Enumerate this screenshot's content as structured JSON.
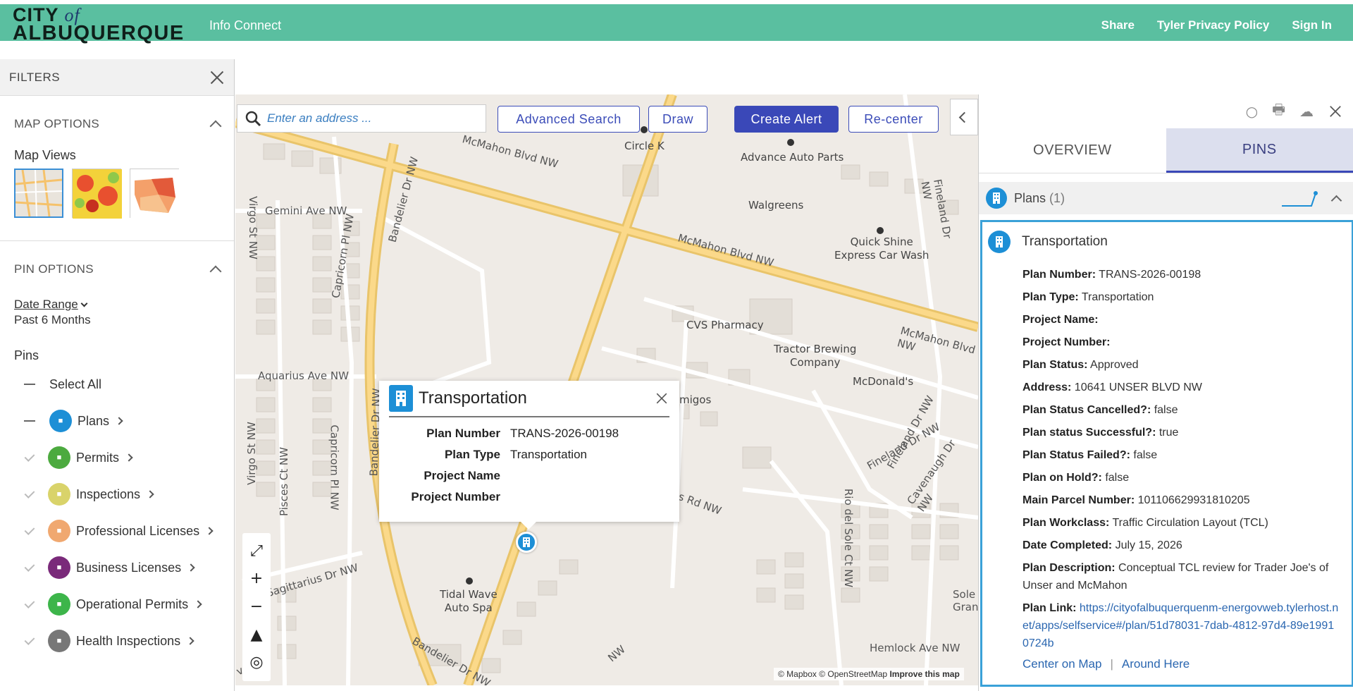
{
  "header": {
    "logo_line1_city": "CITY",
    "logo_line1_of": "of",
    "logo_line2": "ALBUQUERQUE",
    "app_title": "Info Connect",
    "nav": [
      "Share",
      "Tyler Privacy Policy",
      "Sign In"
    ],
    "bg_color": "#5abfa0"
  },
  "filters": {
    "title": "FILTERS",
    "map_options_title": "MAP OPTIONS",
    "map_views_label": "Map Views",
    "pin_options_title": "PIN OPTIONS",
    "date_range_label": "Date Range",
    "date_range_value": "Past 6 Months",
    "pins_title": "Pins",
    "select_all": "Select All",
    "pins": [
      {
        "label": "Plans",
        "color": "#1d8fd6",
        "state": "selected"
      },
      {
        "label": "Permits",
        "color": "#4caa3f",
        "state": "unselected"
      },
      {
        "label": "Inspections",
        "color": "#d9d36a",
        "state": "unselected"
      },
      {
        "label": "Professional Licenses",
        "color": "#f0a870",
        "state": "unselected"
      },
      {
        "label": "Business Licenses",
        "color": "#7a2a7a",
        "state": "unselected"
      },
      {
        "label": "Operational Permits",
        "color": "#3db54a",
        "state": "unselected"
      },
      {
        "label": "Health Inspections",
        "color": "#777777",
        "state": "unselected"
      }
    ]
  },
  "map": {
    "search_placeholder": "Enter an address ...",
    "buttons": {
      "advanced_search": "Advanced Search",
      "draw": "Draw",
      "create_alert": "Create Alert",
      "recenter": "Re-center"
    },
    "attribution": "© Mapbox © OpenStreetMap",
    "attribution_link": "Improve this map",
    "labels": {
      "circle_k": "Circle K",
      "advance_auto": "Advance Auto Parts",
      "walgreens": "Walgreens",
      "quick_shine_1": "Quick Shine",
      "quick_shine_2": "Express Car Wash",
      "cvs": "CVS Pharmacy",
      "tractor_1": "Tractor Brewing",
      "tractor_2": "Company",
      "mcdonalds": "McDonald's",
      "amigos": "migos",
      "tidal_1": "Tidal Wave",
      "tidal_2": "Auto Spa",
      "gemini": "Gemini Ave NW",
      "aquarius": "Aquarius Ave NW",
      "sagittarius": "Sagittarius Dr NW",
      "mcmahon_a": "McMahon Blvd NW",
      "mcmahon_b": "McMahon Blvd NW",
      "mcmahon_c": "McMahon Blvd NW",
      "bandelier_a": "Bandelier Dr NW",
      "bandelier_b": "Bandelier Dr NW",
      "bandelier_c": "Bandelier Dr NW",
      "capricorn_a": "Capricorn Pl NW",
      "capricorn_b": "Capricorn Pl NW",
      "virgo_a": "Virgo St NW",
      "virgo_b": "Virgo St NW",
      "pisces": "Pisces Ct NW",
      "fineland_a": "Fineland Dr NW",
      "fineland_b": "Fineland Dr NW",
      "fineland_c": "Fineland Dr NW",
      "cavenaugh": "Cavenaugh Dr NW",
      "rio_del_sole": "Rio del Sole Ct NW",
      "sole_grande": "Sole Gran",
      "hemlock": "Hemlock Ave NW",
      "ss_rd": "ss Rd NW",
      "ve_nw": "ve NW",
      "nw_bottom": "NW"
    }
  },
  "popup": {
    "title": "Transportation",
    "rows": [
      {
        "k": "Plan Number",
        "v": "TRANS-2026-00198"
      },
      {
        "k": "Plan Type",
        "v": "Transportation"
      },
      {
        "k": "Project Name",
        "v": ""
      },
      {
        "k": "Project Number",
        "v": ""
      }
    ]
  },
  "panel": {
    "tabs": [
      "OVERVIEW",
      "PINS"
    ],
    "active_tab": "PINS",
    "plans_header": "Plans",
    "plans_count": "(1)",
    "card_title": "Transportation",
    "fields": [
      {
        "k": "Plan Number:",
        "v": " TRANS-2026-00198"
      },
      {
        "k": "Plan Type:",
        "v": " Transportation"
      },
      {
        "k": "Project Name:",
        "v": ""
      },
      {
        "k": "Project Number:",
        "v": ""
      },
      {
        "k": "Plan Status:",
        "v": " Approved"
      },
      {
        "k": "Address:",
        "v": " 10641 UNSER BLVD NW"
      },
      {
        "k": "Plan Status Cancelled?:",
        "v": " false"
      },
      {
        "k": "Plan status Successful?:",
        "v": " true"
      },
      {
        "k": "Plan Status Failed?:",
        "v": " false"
      },
      {
        "k": "Plan on Hold?:",
        "v": " false"
      },
      {
        "k": "Main Parcel Number:",
        "v": " 101106629931810205"
      },
      {
        "k": "Plan Workclass:",
        "v": " Traffic Circulation Layout (TCL)"
      },
      {
        "k": "Date Completed:",
        "v": " July 15, 2026"
      },
      {
        "k": "Plan Description:",
        "v": " Conceptual TCL review for Trader Joe's of Unser and McMahon"
      }
    ],
    "plan_link_label": "Plan Link:",
    "plan_link_url": "https://cityofalbuquerquenm-energovweb.tylerhost.net/apps/selfservice#/plan/51d78031-7dab-4812-97d4-89e19910724b",
    "center_on_map": "Center on Map",
    "link_separator": "|",
    "around_here": "Around Here",
    "accent_color": "#3aa1d8"
  }
}
